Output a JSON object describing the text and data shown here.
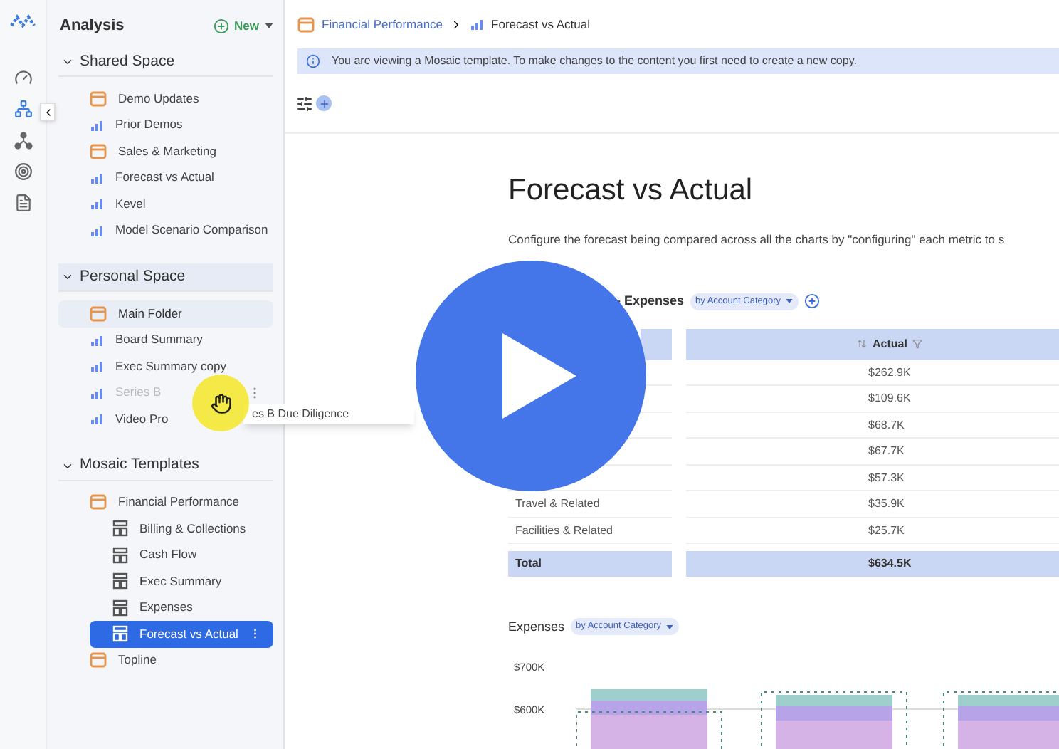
{
  "sidebar": {
    "title": "Analysis",
    "new_button": "New",
    "sections": [
      {
        "title": "Shared Space",
        "highlighted": false,
        "items": [
          {
            "kind": "folder",
            "label": "Demo Updates",
            "selected": false,
            "dimmed": false
          },
          {
            "kind": "report",
            "label": "Prior Demos",
            "selected": false,
            "dimmed": false
          },
          {
            "kind": "folder",
            "label": "Sales & Marketing",
            "selected": false,
            "dimmed": false
          },
          {
            "kind": "report",
            "label": "Forecast vs Actual",
            "selected": false,
            "dimmed": false
          },
          {
            "kind": "report",
            "label": "Kevel",
            "selected": false,
            "dimmed": false
          },
          {
            "kind": "report",
            "label": "Model Scenario Comparison",
            "selected": false,
            "dimmed": false
          }
        ]
      },
      {
        "title": "Personal Space",
        "highlighted": true,
        "items": [
          {
            "kind": "folder",
            "label": "Main Folder",
            "selected": true,
            "dimmed": false
          },
          {
            "kind": "report",
            "label": "Board Summary",
            "selected": false,
            "dimmed": false
          },
          {
            "kind": "report",
            "label": "Exec Summary copy",
            "selected": false,
            "dimmed": false
          },
          {
            "kind": "report",
            "label": "Series B",
            "selected": false,
            "dimmed": true
          },
          {
            "kind": "report",
            "label": "Video Pro",
            "selected": false,
            "dimmed": false
          }
        ]
      },
      {
        "title": "Mosaic Templates",
        "highlighted": false,
        "items": [
          {
            "kind": "folder",
            "label": "Financial Performance",
            "selected": false,
            "dimmed": false,
            "children": [
              {
                "kind": "template",
                "label": "Billing & Collections",
                "selected": false,
                "dimmed": false
              },
              {
                "kind": "template",
                "label": "Cash Flow",
                "selected": false,
                "dimmed": false
              },
              {
                "kind": "template",
                "label": "Exec Summary",
                "selected": false,
                "dimmed": false
              },
              {
                "kind": "template",
                "label": "Expenses",
                "selected": false,
                "dimmed": false
              },
              {
                "kind": "template",
                "label": "Forecast vs Actual",
                "selected": true,
                "dimmed": false
              }
            ]
          },
          {
            "kind": "folder",
            "label": "Topline",
            "selected": false,
            "dimmed": false
          }
        ]
      }
    ],
    "drag_tooltip": "es B Due Diligence"
  },
  "breadcrumb": [
    "Financial Performance",
    "Forecast vs Actual"
  ],
  "info_banner": "You are viewing a Mosaic template. To make changes to the content you first need to create a new copy.",
  "page": {
    "title": "Forecast vs Actual",
    "description": "Configure the forecast being compared across all the charts by \"configuring\" each metric to s"
  },
  "table": {
    "title": "- Expenses",
    "filter": "by Account Category",
    "columns": [
      "Actual"
    ],
    "rows": [
      {
        "actual": "$262.9K"
      },
      {
        "actual": "$109.6K"
      },
      {
        "actual": "$68.7K"
      },
      {
        "actual": "$67.7K"
      },
      {
        "actual": "$57.3K"
      },
      {
        "category": "Travel & Related",
        "actual": "$35.9K"
      },
      {
        "category": "Facilities & Related",
        "actual": "$25.7K"
      }
    ],
    "total": [
      "Total",
      "$634.5K"
    ]
  },
  "chart": {
    "title": "Expenses",
    "filter": "by Account Category",
    "y_tick_labels": [
      "$700K",
      "$600K"
    ]
  }
}
